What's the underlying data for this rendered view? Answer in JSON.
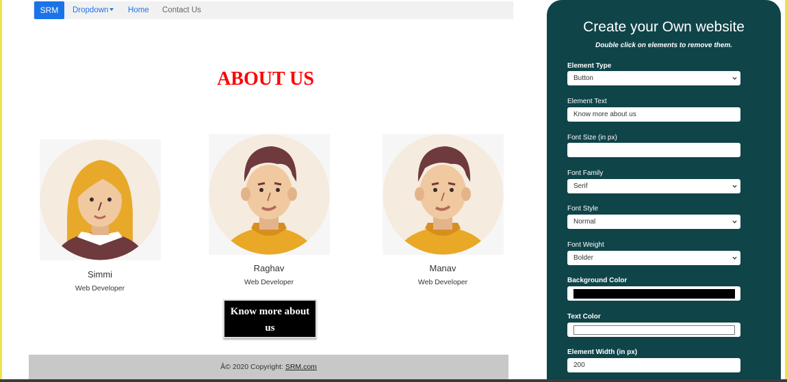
{
  "navbar": {
    "brand": "SRM",
    "dropdown": "Dropdown",
    "home": "Home",
    "contact": "Contact Us"
  },
  "about": {
    "title": "ABOUT US",
    "members": [
      {
        "name": "Simmi",
        "role": "Web Developer"
      },
      {
        "name": "Raghav",
        "role": "Web Developer"
      },
      {
        "name": "Manav",
        "role": "Web Developer"
      }
    ],
    "button_label": "Know more about us"
  },
  "footer": {
    "text": "Â© 2020 Copyright: ",
    "link": "SRM.com"
  },
  "panel": {
    "title": "Create your Own website",
    "subtitle": "Double click on elements to remove them.",
    "fields": {
      "element_type": {
        "label": "Element Type",
        "value": "Button"
      },
      "element_text": {
        "label": "Element Text",
        "value": "Know more about us"
      },
      "font_size": {
        "label": "Font Size (in px)",
        "value": ""
      },
      "font_family": {
        "label": "Font Family",
        "value": "Serif"
      },
      "font_style": {
        "label": "Font Style",
        "value": "Normal"
      },
      "font_weight": {
        "label": "Font Weight",
        "value": "Bolder"
      },
      "background_color": {
        "label": "Background Color",
        "value": "#000000"
      },
      "text_color": {
        "label": "Text Color",
        "value": "#ffffff"
      },
      "element_width": {
        "label": "Element Width (in px)",
        "value": "200"
      }
    }
  },
  "colors": {
    "brand": "#1a73e8",
    "title_red": "#ff0000",
    "panel_bg": "#0f4449"
  }
}
